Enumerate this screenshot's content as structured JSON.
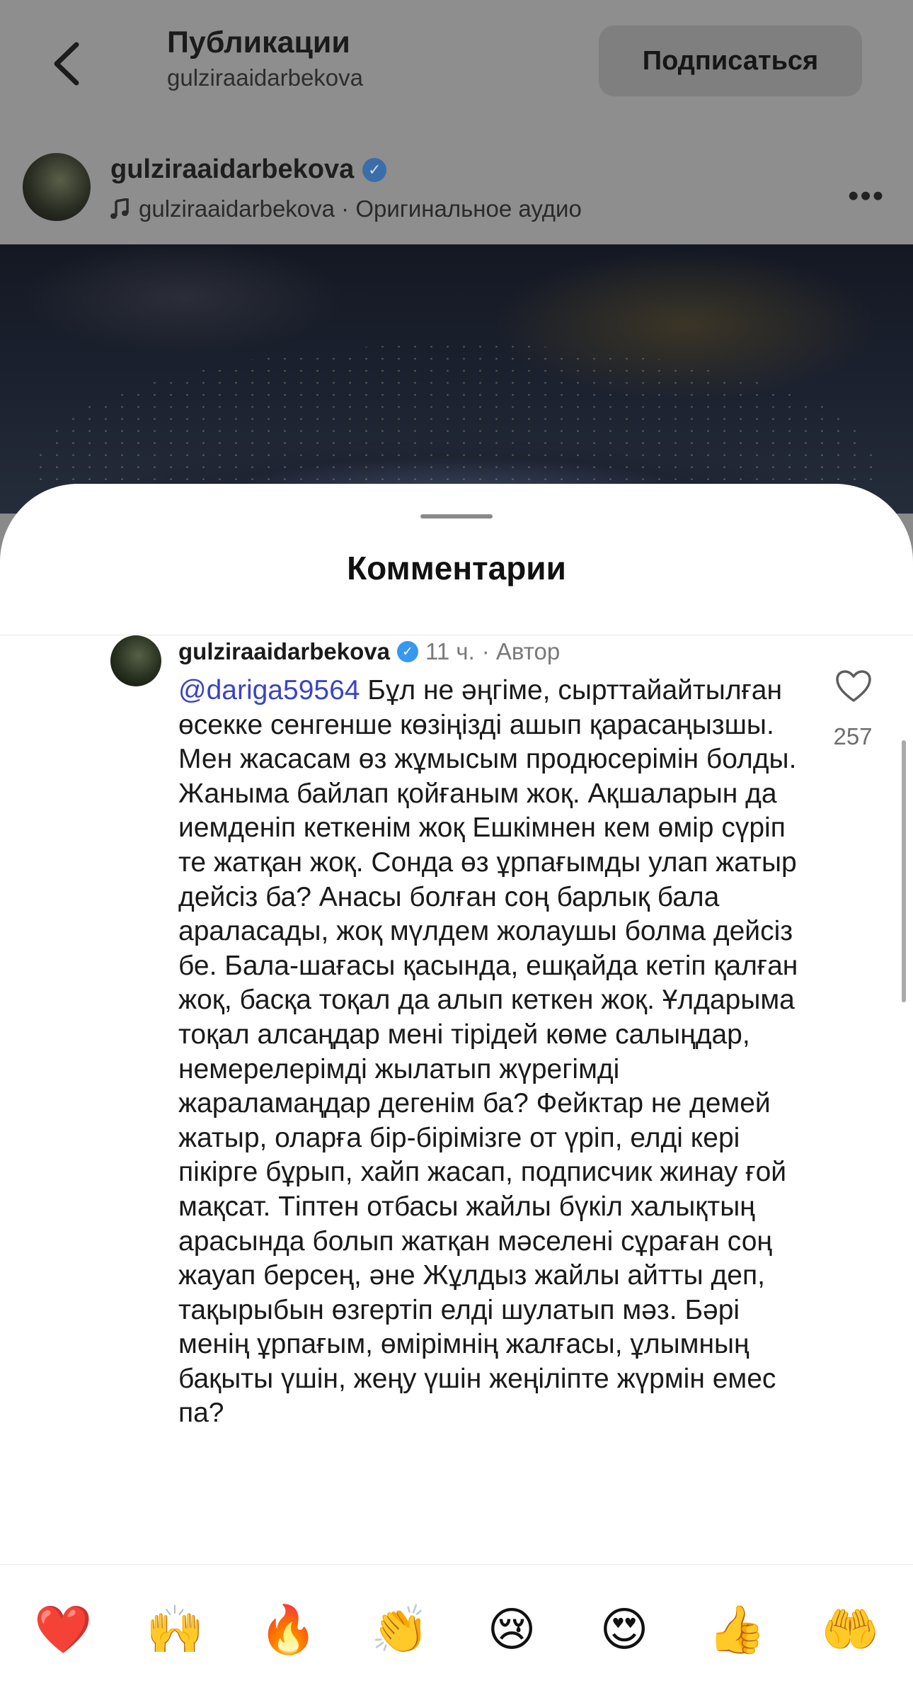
{
  "header": {
    "title": "Публикации",
    "subtitle": "gulziraaidarbekova",
    "subscribe_label": "Подписаться"
  },
  "post": {
    "username": "gulziraaidarbekova",
    "audio": "gulziraaidarbekova · Оригинальное аудио"
  },
  "sheet": {
    "title": "Комментарии"
  },
  "comment": {
    "username": "gulziraaidarbekova",
    "time": "11 ч.",
    "author_tag": "· Автор",
    "mention": "@dariga59564",
    "text": " Бұл не әңгіме, сырттайайтылған өсекке сенгенше көзіңізді ашып қарасаңызшы. Мен жасасам өз жұмысым продюсерімін болды. Жаныма байлап қойғаным жоқ. Ақшаларын да иемденіп кеткенім жоқ Ешкімнен кем өмір сүріп те жатқан жоқ. Сонда өз ұрпағымды улап жатыр дейсіз ба? Анасы болған соң барлық бала араласады, жоқ мүлдем жолаушы болма дейсіз бе. Бала-шағасы қасында, ешқайда кетіп қалған жоқ, басқа тоқал да алып кеткен жоқ. Ұлдарыма тоқал алсаңдар мені тірідей көме салыңдар, немерелерімді жылатып жүрегімді жараламаңдар дегенім ба? Фейктар не демей жатыр, оларға бір-бірімізге от үріп, елді кері пікірге бұрып, хайп жасап, подписчик жинау ғой мақсат. Тіптен отбасы жайлы бүкіл халықтың арасында болып жатқан мәселені сұраған соң жауап берсең, әне Жұлдыз жайлы айтты деп, тақырыбын өзгертіп елді шулатып мәз. Бәрі менің ұрпағым, өмірімнің жалғасы, ұлымның бақыты үшін, жеңу үшін жеңіліпте жүрмін емес па?",
    "like_count": "257"
  },
  "emoji_bar": {
    "items": [
      {
        "name": "red-heart",
        "glyph": "❤️"
      },
      {
        "name": "raising-hands",
        "glyph": "🙌"
      },
      {
        "name": "fire",
        "glyph": "🔥"
      },
      {
        "name": "clapping-hands",
        "glyph": "👏"
      },
      {
        "name": "crying-face",
        "glyph": "😢"
      },
      {
        "name": "heart-eyes",
        "glyph": "😍"
      },
      {
        "name": "thumbs-up",
        "glyph": "👍"
      },
      {
        "name": "open-hands",
        "glyph": "🤲"
      }
    ]
  }
}
